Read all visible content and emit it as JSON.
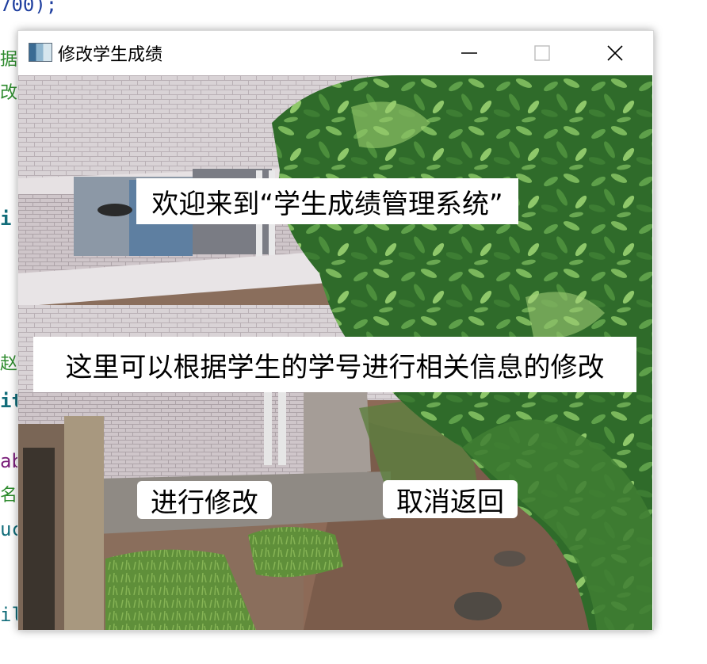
{
  "background_code": {
    "line1": "700);",
    "line2": "据",
    "line3": "改",
    "line4": "i",
    "line5": "赵",
    "line6": "it",
    "line7": "ab",
    "line8": "名",
    "line9": "uc",
    "line10": "il"
  },
  "window": {
    "title": "修改学生成绩",
    "icons": {
      "app": "app-window-icon",
      "minimize": "minimize-icon",
      "maximize": "maximize-icon",
      "close": "close-icon"
    }
  },
  "main": {
    "welcome_text": "欢迎来到“学生成绩管理系统”",
    "info_text": "这里可以根据学生的学号进行相关信息的修改",
    "confirm_button": "进行修改",
    "cancel_button": "取消返回"
  },
  "colors": {
    "code_blue": "#1f3f9f",
    "code_green": "#2e8b2e",
    "code_teal": "#126d7a",
    "code_purple": "#7a1f7a"
  }
}
